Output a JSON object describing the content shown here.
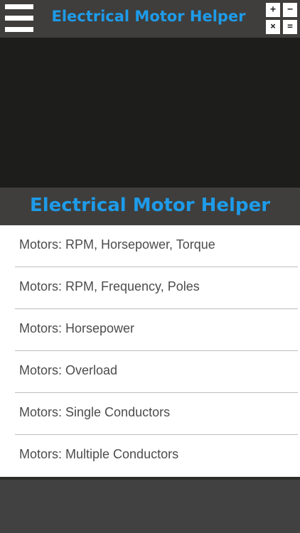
{
  "topbar": {
    "menu_icon": "hamburger-menu-icon",
    "title": "Electrical Motor Helper",
    "calculator_icon": "calculator-icon",
    "calculator_symbols": [
      "+",
      "−",
      "×",
      "="
    ]
  },
  "heading": {
    "title": "Electrical Motor Helper"
  },
  "menu": {
    "items": [
      {
        "label": "Motors: RPM, Horsepower, Torque"
      },
      {
        "label": "Motors: RPM, Frequency, Poles"
      },
      {
        "label": "Motors: Horsepower"
      },
      {
        "label": "Motors: Overload"
      },
      {
        "label": "Motors: Single Conductors"
      },
      {
        "label": "Motors: Multiple Conductors"
      }
    ]
  },
  "colors": {
    "accent": "#1e9be9",
    "bar": "#3f3e3c",
    "banner": "#1d1d1b",
    "list_bg": "#ffffff",
    "list_text": "#4c4c4c"
  }
}
